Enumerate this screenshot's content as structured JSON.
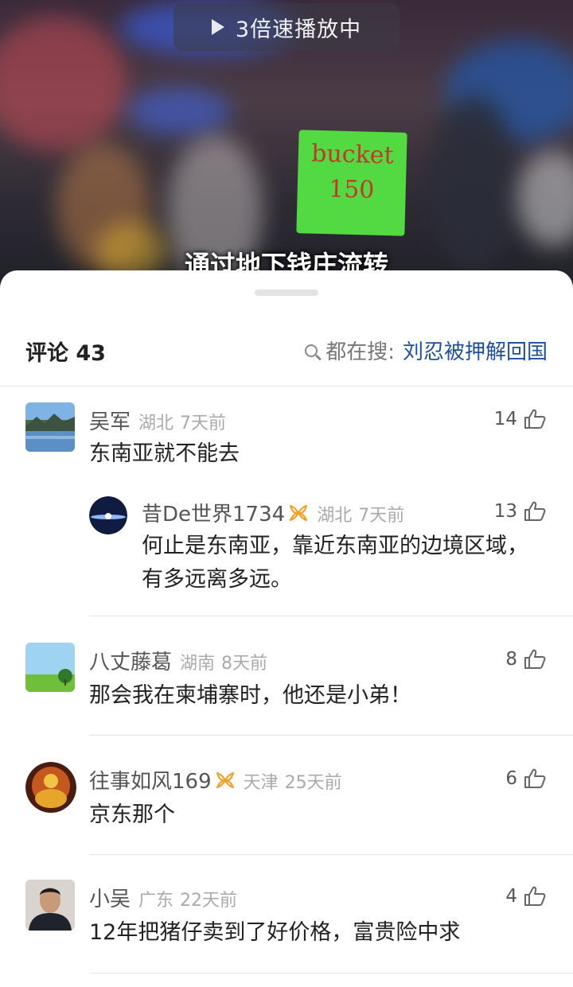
{
  "video": {
    "speed_label": "3倍速播放中",
    "sign_text": [
      "bucket",
      "150"
    ],
    "subtitle": "通过地下钱庄流转"
  },
  "comments_header": {
    "title": "评论 43",
    "search_label": "都在搜:",
    "search_term": "刘忍被押解回国"
  },
  "comments": [
    {
      "user": "吴军",
      "location": "湖北",
      "time": "7天前",
      "likes": "14",
      "text": "东南亚就不能去"
    },
    {
      "user": "昔De世界1734",
      "location": "湖北",
      "time": "7天前",
      "likes": "13",
      "text_lines": [
        "何止是东南亚，靠近东南亚的边境区域，",
        "有多远离多远。"
      ],
      "badge": true
    },
    {
      "user": "八丈藤葛",
      "location": "湖南",
      "time": "8天前",
      "likes": "8",
      "text": "那会我在柬埔寨时，他还是小弟！"
    },
    {
      "user": "往事如风169",
      "location": "天津",
      "time": "25天前",
      "likes": "6",
      "text": "京东那个",
      "badge": true
    },
    {
      "user": "小吴",
      "location": "广东",
      "time": "22天前",
      "likes": "4",
      "text": "12年把猪仔卖到了好价格，富贵险中求"
    }
  ],
  "icons": {
    "like": "thumbs-up-icon",
    "search": "search-icon",
    "badge": "gold-ribbon-badge-icon",
    "play": "play-icon"
  },
  "colors": {
    "search_term": "#1e4e9c",
    "badge": "#f0a22a",
    "sign": "#53d942"
  }
}
